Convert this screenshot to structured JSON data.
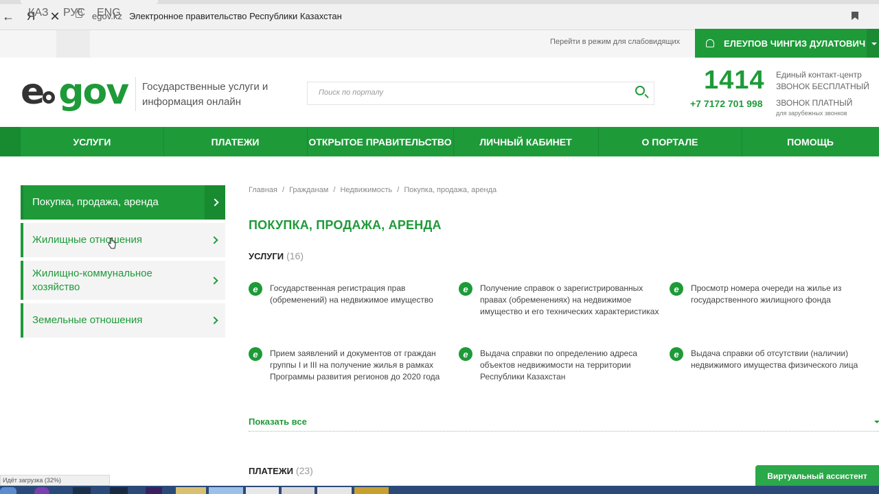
{
  "browser": {
    "domain": "egov.kz",
    "page_title": "Электронное правительство Республики Казахстан",
    "yandex_label": "Я"
  },
  "utility": {
    "languages": [
      "ҚАЗ",
      "РУС",
      "ENG"
    ],
    "low_vision": "Перейти в режим для слабовидящих",
    "user_name": "ЕЛЕУПОВ ЧИНГИЗ ДУЛАТОВИЧ"
  },
  "header": {
    "logo_e": "e",
    "logo_gov": "gov",
    "tagline": "Государственные услуги и информация онлайн",
    "search_placeholder": "Поиск по порталу",
    "phone_short": "1414",
    "phone_short_note_1": "Единый контакт-центр",
    "phone_short_note_2": "ЗВОНОК БЕСПЛАТНЫЙ",
    "phone_long": "+7 7172 701 998",
    "phone_long_note": "ЗВОНОК ПЛАТНЫЙ",
    "phone_long_sub": "для зарубежных звонков"
  },
  "nav": [
    "УСЛУГИ",
    "ПЛАТЕЖИ",
    "ОТКРЫТОЕ ПРАВИТЕЛЬСТВО",
    "ЛИЧНЫЙ КАБИНЕТ",
    "О ПОРТАЛЕ",
    "ПОМОЩЬ"
  ],
  "sidebar": [
    "Покупка, продажа, аренда",
    "Жилищные отношения",
    "Жилищно-коммунальное хозяйство",
    "Земельные отношения"
  ],
  "content": {
    "breadcrumb": [
      "Главная",
      "/",
      "Гражданам",
      "/",
      "Недвижимость",
      "/",
      "Покупка, продажа, аренда"
    ],
    "title": "ПОКУПКА, ПРОДАЖА, АРЕНДА",
    "services_label": "УСЛУГИ",
    "services_count": "(16)",
    "service_icon": "e",
    "services": [
      "Государственная регистрация прав (обременений) на недвижимое имущество",
      "Получение справок о зарегистрированных правах (обременениях) на недвижимое имущество и его технических характеристиках",
      "Просмотр номера очереди на жилье из государственного жилищного фонда",
      "Прием заявлений и документов от граждан группы I и III на получение жилья в рамках Программы развития регионов до 2020 года",
      "Выдача справки по определению адреса объектов недвижимости на территории Республики Казахстан",
      "Выдача справки об отсутствии (наличии) недвижимого имущества физического лица"
    ],
    "show_all": "Показать все",
    "payments_label": "ПЛАТЕЖИ",
    "payments_count": "(23)"
  },
  "status_text": "Идёт загрузка (32%)",
  "assistant": "Виртуальный ассистент",
  "colors": {
    "brand_green": "#1e9a39",
    "dark_green": "#188a30"
  }
}
